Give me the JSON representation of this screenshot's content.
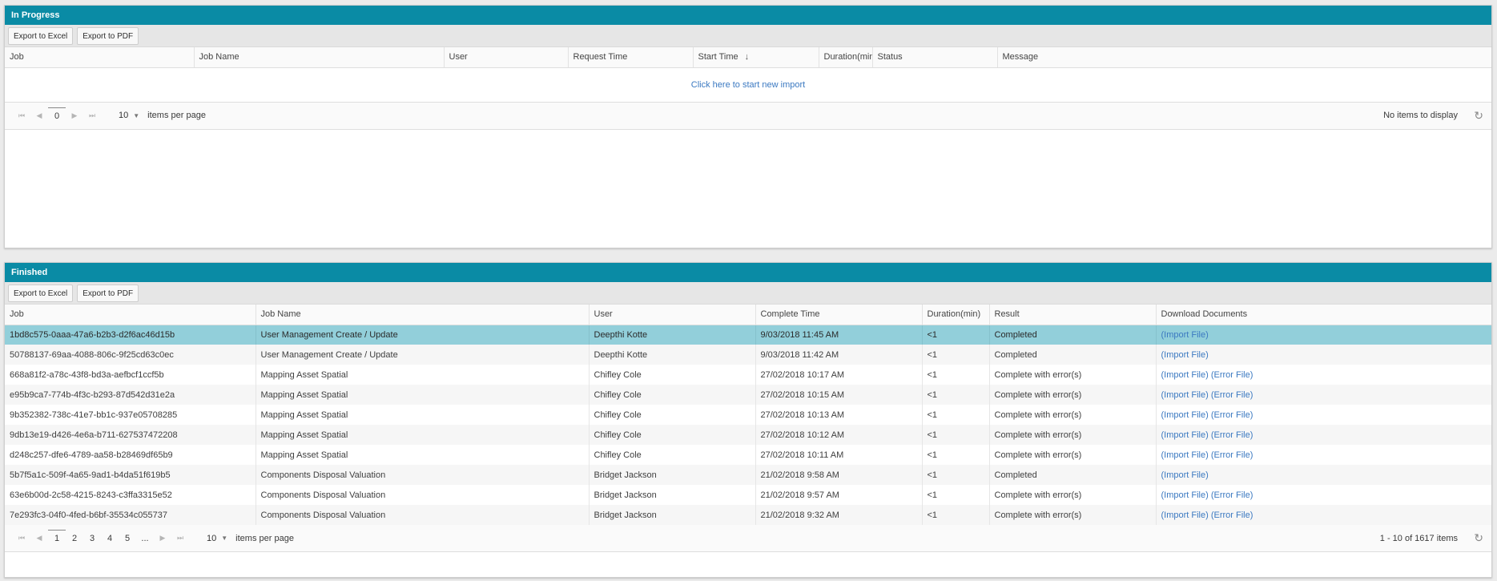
{
  "in_progress": {
    "title": "In Progress",
    "export_excel": "Export to Excel",
    "export_pdf": "Export to PDF",
    "columns": [
      "Job",
      "Job Name",
      "User",
      "Request Time",
      "Start Time",
      "Duration(min)",
      "Status",
      "Message"
    ],
    "sort_icon": "↓",
    "empty_link": "Click here to start new import",
    "pager": {
      "first": "⏮",
      "prev": "◀",
      "next": "▶",
      "last": "⏭",
      "current_page": "0",
      "page_size": "10",
      "caret": "▼",
      "items_per_page": "items per page",
      "info": "No items to display",
      "refresh": "↻"
    }
  },
  "finished": {
    "title": "Finished",
    "export_excel": "Export to Excel",
    "export_pdf": "Export to PDF",
    "columns": [
      "Job",
      "Job Name",
      "User",
      "Complete Time",
      "Duration(min)",
      "Result",
      "Download Documents"
    ],
    "rows": [
      {
        "job": "1bd8c575-0aaa-47a6-b2b3-d2f6ac46d15b",
        "job_name": "User Management Create / Update",
        "user": "Deepthi Kotte",
        "complete_time": "9/03/2018 11:45 AM",
        "duration": "<1",
        "result": "Completed",
        "import_link": "(Import File)",
        "error_link": ""
      },
      {
        "job": "50788137-69aa-4088-806c-9f25cd63c0ec",
        "job_name": "User Management Create / Update",
        "user": "Deepthi Kotte",
        "complete_time": "9/03/2018 11:42 AM",
        "duration": "<1",
        "result": "Completed",
        "import_link": "(Import File)",
        "error_link": ""
      },
      {
        "job": "668a81f2-a78c-43f8-bd3a-aefbcf1ccf5b",
        "job_name": "Mapping Asset Spatial",
        "user": "Chifley Cole",
        "complete_time": "27/02/2018 10:17 AM",
        "duration": "<1",
        "result": "Complete with error(s)",
        "import_link": "(Import File)",
        "error_link": "(Error File)"
      },
      {
        "job": "e95b9ca7-774b-4f3c-b293-87d542d31e2a",
        "job_name": "Mapping Asset Spatial",
        "user": "Chifley Cole",
        "complete_time": "27/02/2018 10:15 AM",
        "duration": "<1",
        "result": "Complete with error(s)",
        "import_link": "(Import File)",
        "error_link": "(Error File)"
      },
      {
        "job": "9b352382-738c-41e7-bb1c-937e05708285",
        "job_name": "Mapping Asset Spatial",
        "user": "Chifley Cole",
        "complete_time": "27/02/2018 10:13 AM",
        "duration": "<1",
        "result": "Complete with error(s)",
        "import_link": "(Import File)",
        "error_link": "(Error File)"
      },
      {
        "job": "9db13e19-d426-4e6a-b711-627537472208",
        "job_name": "Mapping Asset Spatial",
        "user": "Chifley Cole",
        "complete_time": "27/02/2018 10:12 AM",
        "duration": "<1",
        "result": "Complete with error(s)",
        "import_link": "(Import File)",
        "error_link": "(Error File)"
      },
      {
        "job": "d248c257-dfe6-4789-aa58-b28469df65b9",
        "job_name": "Mapping Asset Spatial",
        "user": "Chifley Cole",
        "complete_time": "27/02/2018 10:11 AM",
        "duration": "<1",
        "result": "Complete with error(s)",
        "import_link": "(Import File)",
        "error_link": "(Error File)"
      },
      {
        "job": "5b7f5a1c-509f-4a65-9ad1-b4da51f619b5",
        "job_name": "Components Disposal Valuation",
        "user": "Bridget Jackson",
        "complete_time": "21/02/2018 9:58 AM",
        "duration": "<1",
        "result": "Completed",
        "import_link": "(Import File)",
        "error_link": ""
      },
      {
        "job": "63e6b00d-2c58-4215-8243-c3ffa3315e52",
        "job_name": "Components Disposal Valuation",
        "user": "Bridget Jackson",
        "complete_time": "21/02/2018 9:57 AM",
        "duration": "<1",
        "result": "Complete with error(s)",
        "import_link": "(Import File)",
        "error_link": "(Error File)"
      },
      {
        "job": "7e293fc3-04f0-4fed-b6bf-35534c055737",
        "job_name": "Components Disposal Valuation",
        "user": "Bridget Jackson",
        "complete_time": "21/02/2018 9:32 AM",
        "duration": "<1",
        "result": "Complete with error(s)",
        "import_link": "(Import File)",
        "error_link": "(Error File)"
      }
    ],
    "pager": {
      "first": "⏮",
      "prev": "◀",
      "next": "▶",
      "last": "⏭",
      "pages": [
        "1",
        "2",
        "3",
        "4",
        "5",
        "..."
      ],
      "page_size": "10",
      "caret": "▼",
      "items_per_page": "items per page",
      "info": "1 - 10 of 1617 items",
      "refresh": "↻"
    }
  },
  "colors": {
    "header_bg": "#0a8ba5",
    "selected_row": "#92cfda",
    "link": "#3b79c1"
  }
}
